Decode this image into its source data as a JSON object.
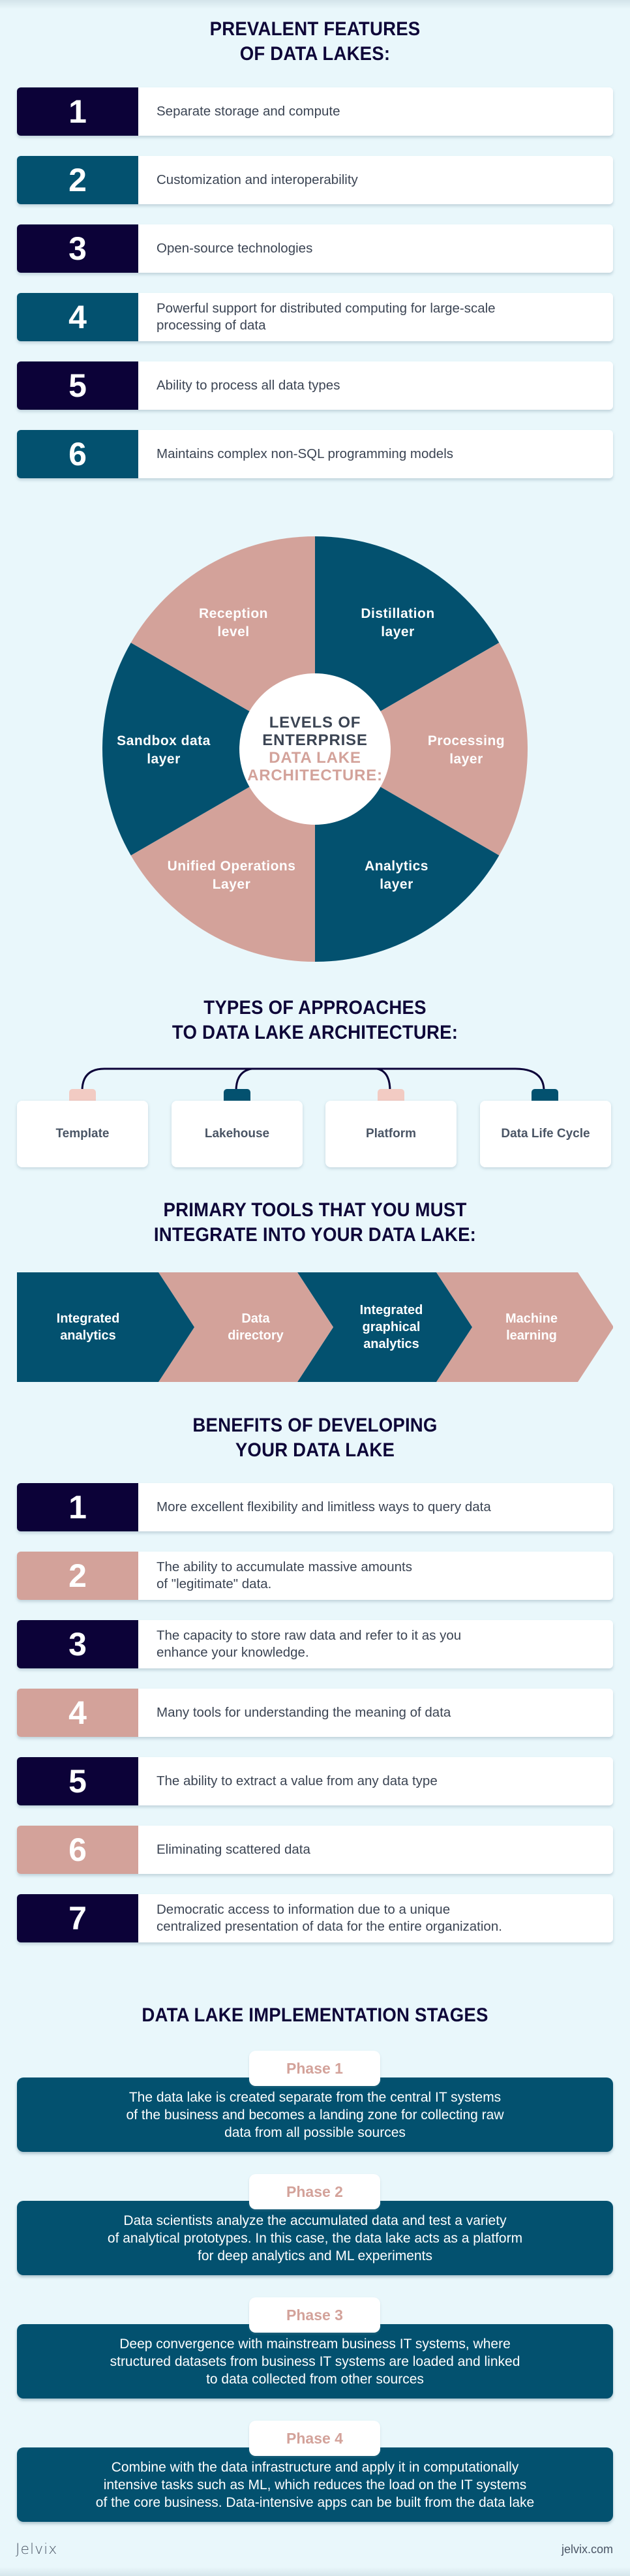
{
  "features": {
    "title_lines": [
      "PREVALENT FEATURES",
      "OF DATA LAKES:"
    ],
    "items": [
      {
        "number": "1",
        "text": "Separate storage and compute",
        "color": "#0c0238"
      },
      {
        "number": "2",
        "text": "Customization and interoperability",
        "color": "#03516f"
      },
      {
        "number": "3",
        "text": "Open-source technologies",
        "color": "#0c0238"
      },
      {
        "number": "4",
        "text": "Powerful support for distributed computing for large-scale\nprocessing of data",
        "color": "#03516f"
      },
      {
        "number": "5",
        "text": "Ability to process all data types",
        "color": "#0c0238"
      },
      {
        "number": "6",
        "text": "Maintains complex non-SQL programming models",
        "color": "#03516f"
      }
    ]
  },
  "architecture": {
    "center_line1": [
      "LEVELS OF",
      "ENTERPRISE"
    ],
    "center_line2": [
      "DATA LAKE",
      "ARCHITECTURE:"
    ],
    "segments": [
      {
        "label": "Distillation\nlayer",
        "color": "#03516f"
      },
      {
        "label": "Processing\nlayer",
        "color": "#d3a29a"
      },
      {
        "label": "Analytics\nlayer",
        "color": "#03516f"
      },
      {
        "label": "Unified Operations\nLayer",
        "color": "#d3a29a"
      },
      {
        "label": "Sandbox data\nlayer",
        "color": "#03516f"
      },
      {
        "label": "Reception\nlevel",
        "color": "#d3a29a"
      }
    ]
  },
  "approaches": {
    "title_lines": [
      "TYPES OF APPROACHES",
      "TO DATA LAKE ARCHITECTURE:"
    ],
    "items": [
      {
        "label": "Template",
        "tab_color": "#f2cbc3"
      },
      {
        "label": "Lakehouse",
        "tab_color": "#03516f"
      },
      {
        "label": "Platform",
        "tab_color": "#f2cbc3"
      },
      {
        "label": "Data Life Cycle",
        "tab_color": "#03516f"
      }
    ]
  },
  "tools": {
    "title_lines": [
      "PRIMARY TOOLS THAT YOU MUST",
      "INTEGRATE INTO YOUR DATA LAKE:"
    ],
    "items": [
      {
        "label": "Integrated\nanalytics",
        "color": "#03516f"
      },
      {
        "label": "Data\ndirectory",
        "color": "#d3a29a"
      },
      {
        "label": "Integrated\ngraphical\nanalytics",
        "color": "#03516f"
      },
      {
        "label": "Machine\nlearning",
        "color": "#d3a29a"
      }
    ]
  },
  "benefits": {
    "title_lines": [
      "BENEFITS OF DEVELOPING",
      "YOUR DATA LAKE"
    ],
    "items": [
      {
        "number": "1",
        "text": "More excellent flexibility and limitless ways to query data",
        "color": "#0c0238"
      },
      {
        "number": "2",
        "text": "The ability to accumulate massive amounts\nof \"legitimate\" data.",
        "color": "#d3a29a"
      },
      {
        "number": "3",
        "text": "The capacity to store raw data and refer to it as you\nenhance your knowledge.",
        "color": "#0c0238"
      },
      {
        "number": "4",
        "text": "Many tools for understanding the meaning of data",
        "color": "#d3a29a"
      },
      {
        "number": "5",
        "text": "The ability to extract a value from any data type",
        "color": "#0c0238"
      },
      {
        "number": "6",
        "text": "Eliminating scattered data",
        "color": "#d3a29a"
      },
      {
        "number": "7",
        "text": "Democratic access to information due to a unique\ncentralized presentation of data for the entire organization.",
        "color": "#0c0238"
      }
    ]
  },
  "stages": {
    "title": "DATA LAKE IMPLEMENTATION STAGES",
    "phases": [
      {
        "label": "Phase 1",
        "text": "The data lake is created separate from the central IT systems\nof the business and becomes a landing zone for collecting raw\ndata from all possible sources"
      },
      {
        "label": "Phase 2",
        "text": "Data scientists analyze the accumulated data and test a variety\nof analytical prototypes. In this case, the data lake acts as a platform\nfor deep analytics and ML experiments"
      },
      {
        "label": "Phase 3",
        "text": "Deep convergence with mainstream business IT systems, where\nstructured datasets from business IT systems are loaded and linked\nto data collected from other sources"
      },
      {
        "label": "Phase 4",
        "text": "Combine with the data infrastructure and apply it in computationally\nintensive tasks such as ML, which reduces the load on the IT systems\nof the core business. Data-intensive apps can be built from the data lake"
      }
    ]
  },
  "footer": {
    "brand": "Jelvix",
    "url": "jelvix.com"
  }
}
